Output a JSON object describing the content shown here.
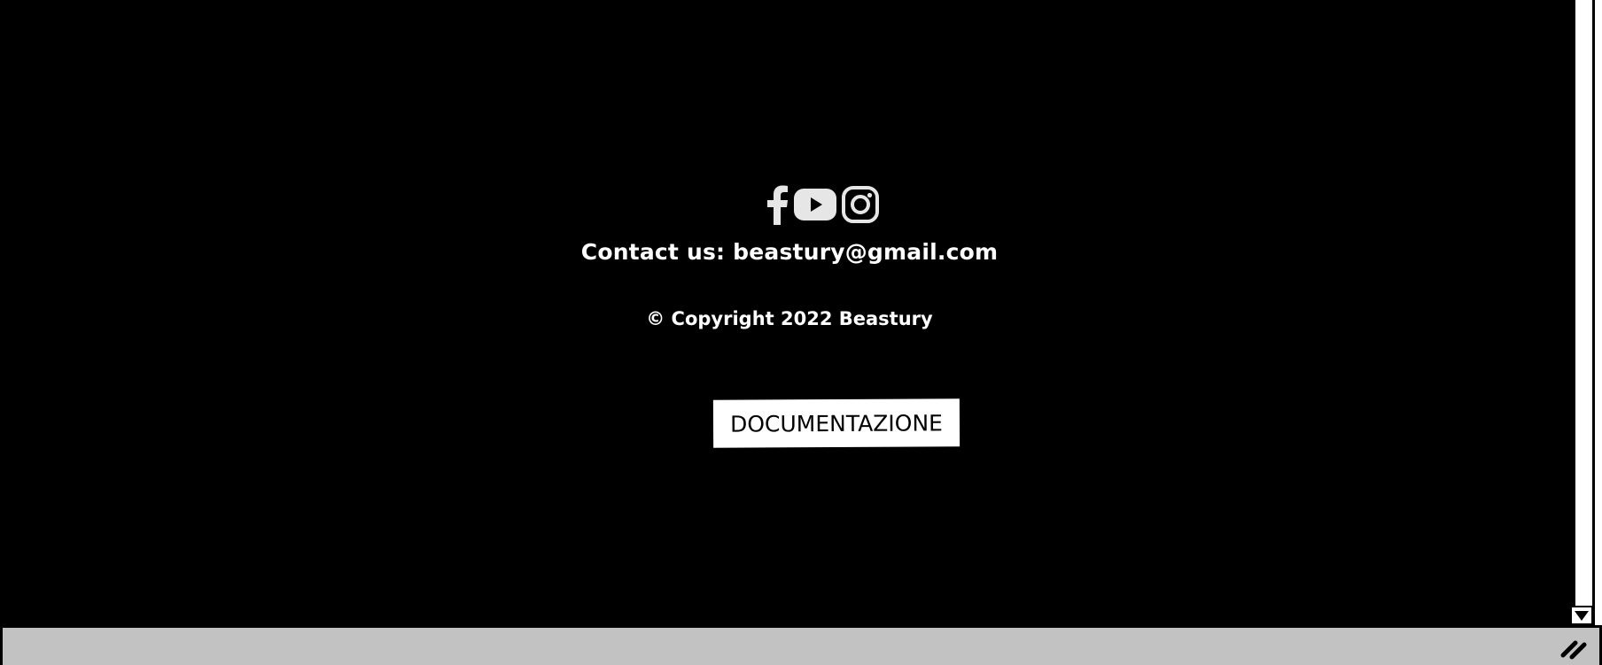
{
  "footer": {
    "social_icons": [
      "facebook-icon",
      "youtube-icon",
      "instagram-icon"
    ],
    "contact_text": "Contact us: beastury@gmail.com",
    "copyright_text": "© Copyright 2022 Beastury",
    "documentation_button": "DOCUMENTAZIONE"
  },
  "colors": {
    "background": "#000000",
    "text": "#ffffff",
    "statusbar": "#c2c2c2",
    "button_bg": "#ffffff"
  }
}
